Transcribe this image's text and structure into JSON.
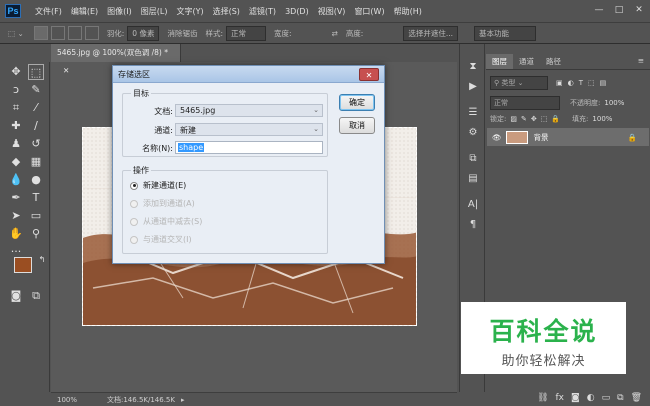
{
  "menubar": {
    "logo": "Ps",
    "items": [
      "文件(F)",
      "编辑(E)",
      "图像(I)",
      "图层(L)",
      "文字(Y)",
      "选择(S)",
      "滤镜(T)",
      "3D(D)",
      "视图(V)",
      "窗口(W)",
      "帮助(H)"
    ],
    "minimize": "—",
    "maximize": "□",
    "close": "✕"
  },
  "options": {
    "feather_label": "羽化:",
    "feather_value": "0 像素",
    "antialias": "消除锯齿",
    "style_label": "样式:",
    "style_value": "正常",
    "width_label": "宽度:",
    "height_label": "高度:",
    "select_mask": "选择并遮住...",
    "workspace": "基本功能"
  },
  "document": {
    "tab_title": "5465.jpg @ 100%(双色调 /8) *",
    "zoom": "100%",
    "doc_info": "文档:146.5K/146.5K"
  },
  "panel": {
    "tabs": [
      "图层",
      "通道",
      "路径"
    ],
    "kind_label": "类型",
    "blend_mode": "正常",
    "opacity_label": "不透明度:",
    "opacity_value": "100%",
    "lock_label": "锁定:",
    "fill_label": "填充:",
    "fill_value": "100%",
    "layer_name": "背景"
  },
  "dialog": {
    "title": "存储选区",
    "close": "✕",
    "target_group": "目标",
    "doc_label": "文档:",
    "doc_value": "5465.jpg",
    "channel_label": "通道:",
    "channel_value": "新建",
    "name_label": "名称(N):",
    "name_value": "shape",
    "operation_group": "操作",
    "ops": [
      "新建通道(E)",
      "添加到通道(A)",
      "从通道中减去(S)",
      "与通道交叉(I)"
    ],
    "ok": "确定",
    "cancel": "取消"
  },
  "colors": {
    "foreground": "#9a4e22",
    "background": "#ffffff",
    "image_brown": "#9a5a37"
  },
  "watermark": {
    "title": "百科全说",
    "subtitle": "助你轻松解决"
  }
}
